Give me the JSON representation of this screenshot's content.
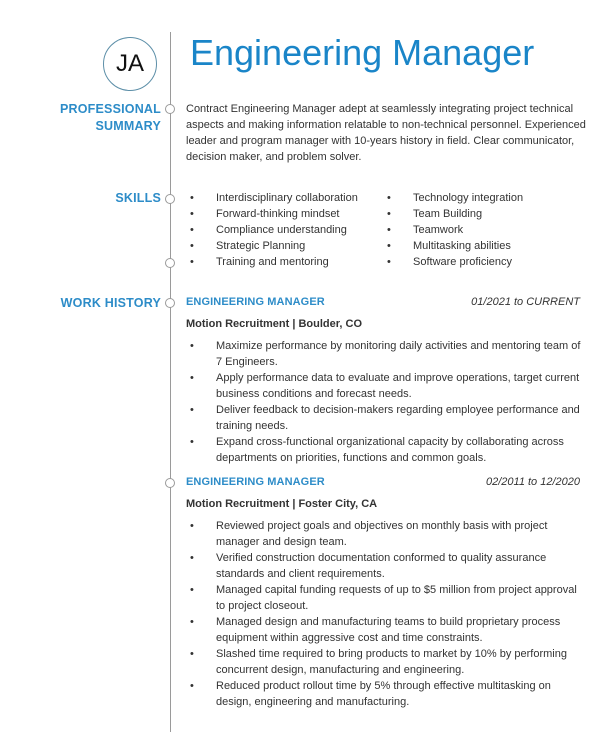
{
  "header": {
    "initials": "JA",
    "name": "Engineering Manager"
  },
  "summary": {
    "label_line1": "PROFESSIONAL",
    "label_line2": "SUMMARY",
    "text": "Contract Engineering Manager adept at seamlessly integrating project technical aspects and making information relatable to non-technical personnel. Experienced leader and program manager with 10-years history in field. Clear communicator, decision maker, and problem solver."
  },
  "skills": {
    "label": "SKILLS",
    "column1": [
      "Interdisciplinary collaboration",
      "Forward-thinking mindset",
      "Compliance understanding",
      "Strategic Planning",
      "Training and mentoring"
    ],
    "column2": [
      "Technology integration",
      "Team Building",
      "Teamwork",
      "Multitasking abilities",
      "Software proficiency"
    ]
  },
  "work_history": {
    "label": "WORK HISTORY",
    "jobs": [
      {
        "title": "ENGINEERING MANAGER",
        "dates": "01/2021 to CURRENT",
        "company": "Motion Recruitment | Boulder, CO",
        "bullets": [
          "Maximize performance by monitoring daily activities and mentoring team of 7 Engineers.",
          "Apply performance data to evaluate and improve operations, target current business conditions and forecast needs.",
          "Deliver feedback to decision-makers regarding employee performance and training needs.",
          "Expand cross-functional organizational capacity by collaborating across departments on priorities, functions and common goals."
        ]
      },
      {
        "title": "ENGINEERING MANAGER",
        "dates": "02/2011 to 12/2020",
        "company": "Motion Recruitment | Foster City, CA",
        "bullets": [
          "Reviewed project goals and objectives on monthly basis with project manager and design team.",
          "Verified construction documentation conformed to quality assurance standards and client requirements.",
          "Managed capital funding requests of up to $5 million from project approval to project closeout.",
          "Managed design and manufacturing teams to build proprietary process equipment within aggressive cost and time constraints.",
          "Slashed time required to bring products to market by 10% by performing concurrent design, manufacturing and engineering.",
          "Reduced product rollout time by 5% through effective multitasking on design, engineering and manufacturing."
        ]
      }
    ]
  },
  "colors": {
    "accent": "#1a85c8",
    "section_label": "#2d8cc8",
    "text": "#333333",
    "timeline": "#9a9a9a"
  }
}
